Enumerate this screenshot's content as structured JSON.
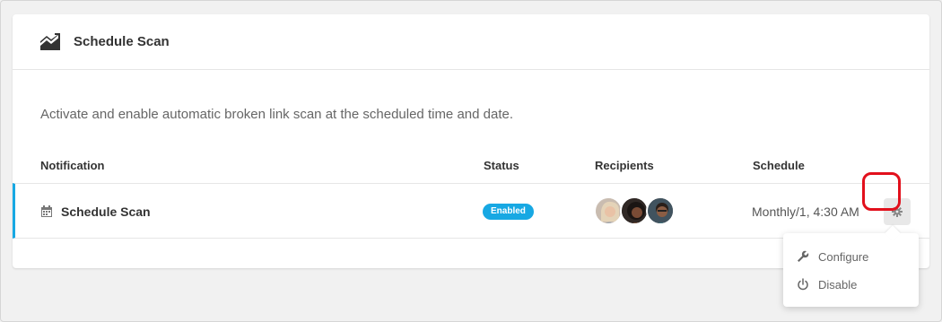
{
  "widget": {
    "title": "Schedule Scan",
    "title_icon": "chart-trend-icon",
    "description": "Activate and enable automatic broken link scan at the scheduled time and date."
  },
  "table": {
    "headers": {
      "notification": "Notification",
      "status": "Status",
      "recipients": "Recipients",
      "schedule": "Schedule"
    },
    "row": {
      "name": "Schedule Scan",
      "name_icon": "calendar-icon",
      "status": "Enabled",
      "recipients": [
        {
          "name": "recipient-1"
        },
        {
          "name": "recipient-2"
        },
        {
          "name": "recipient-3"
        }
      ],
      "schedule": "Monthly/1, 4:30 AM"
    }
  },
  "menu": {
    "items": [
      {
        "label": "Configure",
        "icon": "wrench-icon"
      },
      {
        "label": "Disable",
        "icon": "power-icon"
      }
    ]
  },
  "colors": {
    "accent": "#17a8e3",
    "highlight": "#e2101c"
  }
}
